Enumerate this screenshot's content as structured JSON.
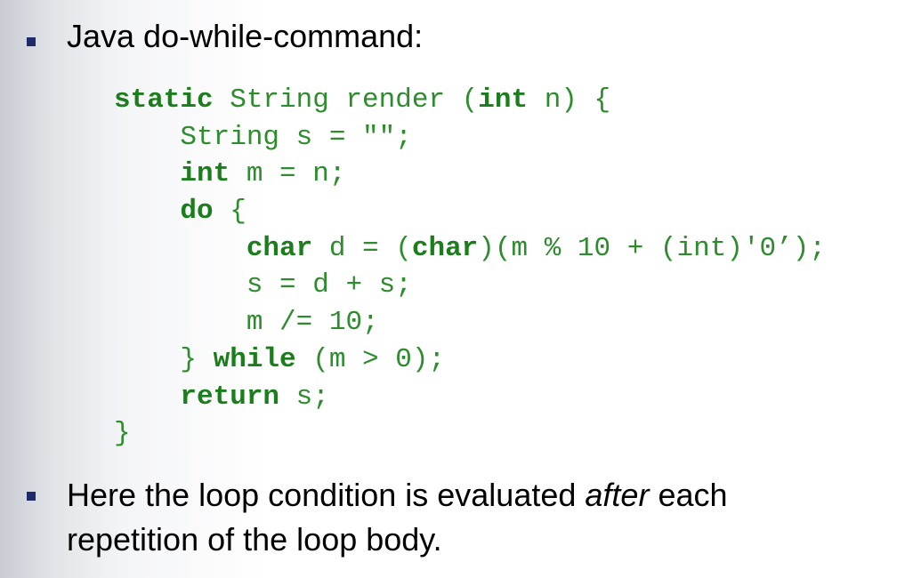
{
  "bullet1": {
    "text": "Java do-while-command:"
  },
  "code": {
    "lines": [
      [
        {
          "t": "static",
          "kw": true
        },
        {
          "t": " String render ("
        },
        {
          "t": "int",
          "kw": true
        },
        {
          "t": " n) {"
        }
      ],
      [
        {
          "t": "    String s = \"\";"
        }
      ],
      [
        {
          "t": "    "
        },
        {
          "t": "int",
          "kw": true
        },
        {
          "t": " m = n;"
        }
      ],
      [
        {
          "t": "    "
        },
        {
          "t": "do",
          "kw": true
        },
        {
          "t": " {"
        }
      ],
      [
        {
          "t": "        "
        },
        {
          "t": "char",
          "kw": true
        },
        {
          "t": " d = ("
        },
        {
          "t": "char",
          "kw": true
        },
        {
          "t": ")(m % 10 + (int)'0’);"
        }
      ],
      [
        {
          "t": "        s = d + s;"
        }
      ],
      [
        {
          "t": "        m /= 10;"
        }
      ],
      [
        {
          "t": "    } "
        },
        {
          "t": "while",
          "kw": true
        },
        {
          "t": " (m > 0);"
        }
      ],
      [
        {
          "t": "    "
        },
        {
          "t": "return",
          "kw": true
        },
        {
          "t": " s;"
        }
      ],
      [
        {
          "t": "}"
        }
      ]
    ]
  },
  "bullet2": {
    "before": "Here the loop condition is evaluated ",
    "emph": "after",
    "after": " each repetition of the loop body."
  }
}
